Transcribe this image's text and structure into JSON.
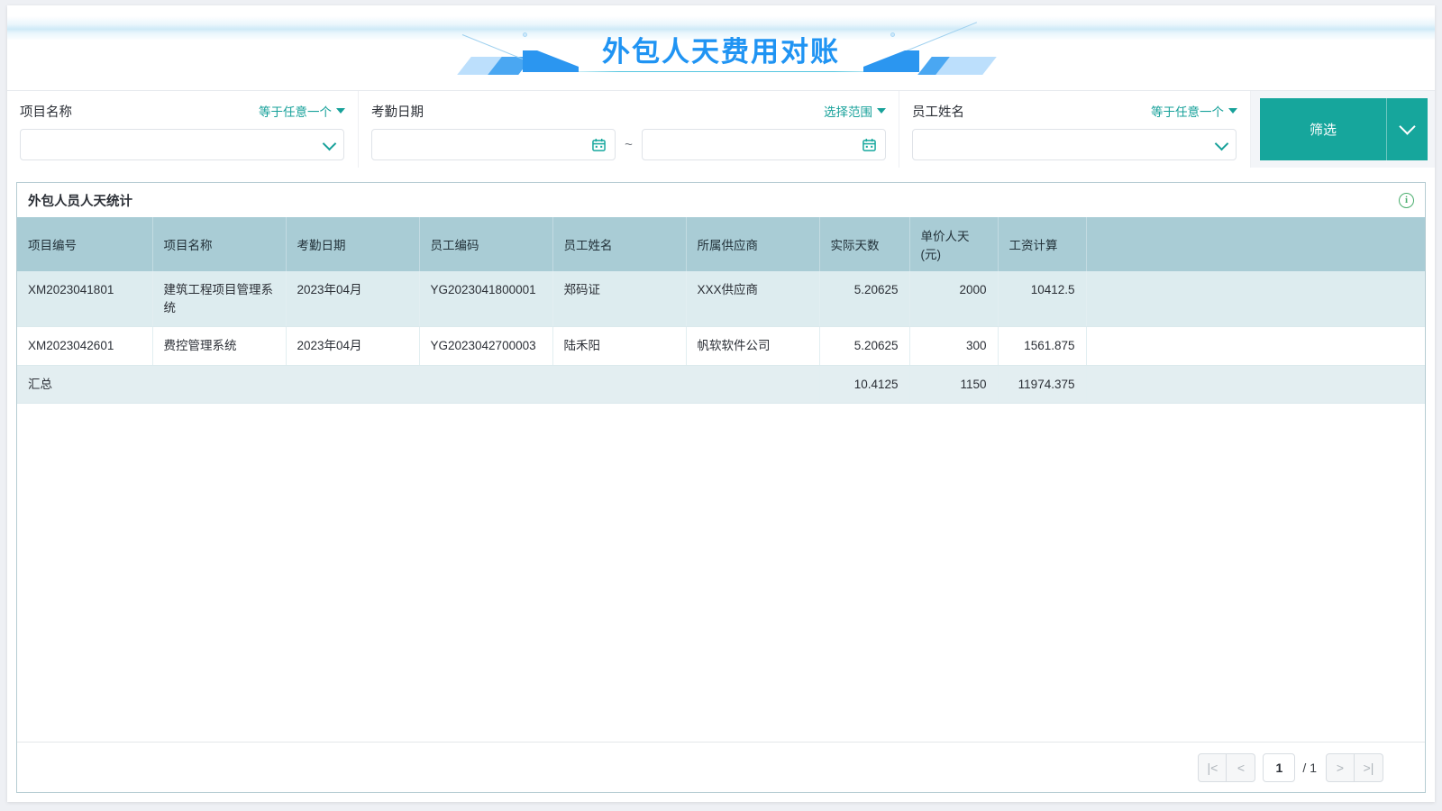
{
  "banner": {
    "title": "外包人天费用对账"
  },
  "filters": {
    "project": {
      "label": "项目名称",
      "operator": "等于任意一个",
      "value": "",
      "caret_icon": "caret-down-icon",
      "chevron_icon": "chevron-down-icon"
    },
    "date": {
      "label": "考勤日期",
      "operator": "选择范围",
      "start_value": "",
      "end_value": "",
      "separator": "~",
      "calendar_icon": "calendar-icon"
    },
    "employee": {
      "label": "员工姓名",
      "operator": "等于任意一个",
      "value": "",
      "chevron_icon": "chevron-down-icon"
    },
    "submit": {
      "label": "筛选",
      "expand_icon": "chevron-down-icon"
    }
  },
  "panel": {
    "title": "外包人员人天统计",
    "info_icon": "info-icon",
    "info_glyph": "i"
  },
  "table": {
    "columns": [
      "项目编号",
      "项目名称",
      "考勤日期",
      "员工编码",
      "员工姓名",
      "所属供应商",
      "实际天数",
      "单价人天\n(元)",
      "工资计算",
      ""
    ],
    "columns_display": {
      "c0": "项目编号",
      "c1": "项目名称",
      "c2": "考勤日期",
      "c3": "员工编码",
      "c4": "员工姓名",
      "c5": "所属供应商",
      "c6": "实际天数",
      "c7_line1": "单价人天",
      "c7_line2": "(元)",
      "c8": "工资计算",
      "c9": ""
    },
    "rows": [
      {
        "project_code": "XM2023041801",
        "project_name": "建筑工程项目管理系统",
        "attendance_month": "2023年04月",
        "employee_code": "YG2023041800001",
        "employee_name": "郑码证",
        "supplier": "XXX供应商",
        "actual_days": "5.20625",
        "unit_price": "2000",
        "salary": "10412.5",
        "extra": ""
      },
      {
        "project_code": "XM2023042601",
        "project_name": "费控管理系统",
        "attendance_month": "2023年04月",
        "employee_code": "YG2023042700003",
        "employee_name": "陆禾阳",
        "supplier": "帆软软件公司",
        "actual_days": "5.20625",
        "unit_price": "300",
        "salary": "1561.875",
        "extra": ""
      }
    ],
    "summary": {
      "label": "汇总",
      "actual_days": "10.4125",
      "unit_price": "1150",
      "salary": "11974.375",
      "extra": ""
    }
  },
  "pagination": {
    "first_icon": "|<",
    "prev_icon": "<",
    "current_page": "1",
    "total_label": "/ 1",
    "next_icon": ">",
    "last_icon": ">|"
  },
  "colors": {
    "accent_teal": "#16a69c",
    "title_blue": "#2094f3",
    "table_header": "#a9ccd5",
    "row_tint": "#ddecef",
    "summary_tint": "#e3eef1",
    "info_green": "#4aae6e"
  }
}
